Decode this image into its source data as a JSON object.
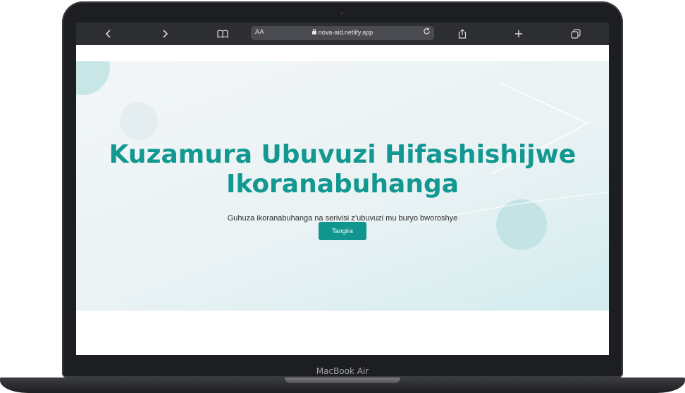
{
  "browser": {
    "text_size_label": "AA",
    "url": "nova-aid.netlify.app",
    "icons": {
      "back": "chevron-left-icon",
      "forward": "chevron-right-icon",
      "bookmarks": "book-icon",
      "reload": "reload-icon",
      "share": "share-icon",
      "new_tab": "plus-icon",
      "tabs": "tabs-icon"
    }
  },
  "hero": {
    "title": "Kuzamura Ubuvuzi Hifashishijwe Ikoranabuhanga",
    "subtitle": "Guhuza ikoranabuhanga na serivisi z’ubuvuzi mu buryo bworoshye",
    "cta_label": "Tangira"
  },
  "device": {
    "model": "MacBook Air"
  },
  "colors": {
    "accent": "#129890",
    "button": "#11968f",
    "toolbar": "#2d2e31"
  }
}
